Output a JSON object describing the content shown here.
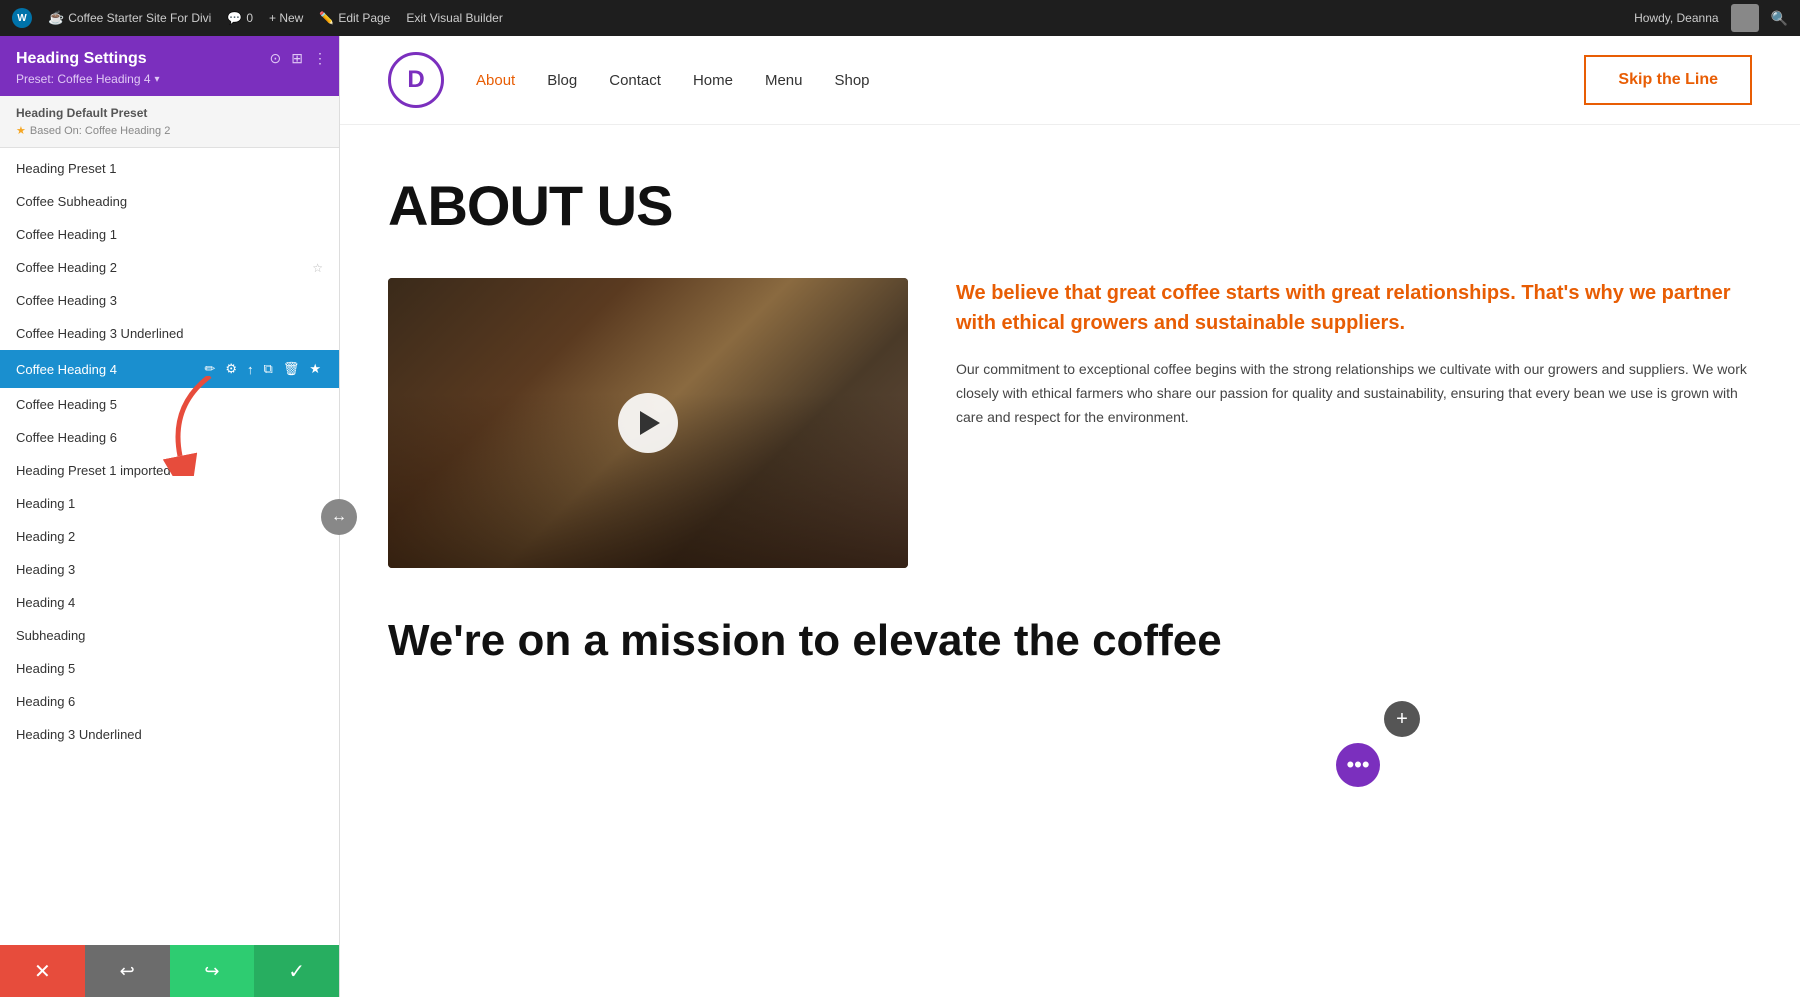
{
  "adminBar": {
    "siteName": "Coffee Starter Site For Divi",
    "commentCount": "0",
    "newLabel": "+ New",
    "editPageLabel": "Edit Page",
    "exitBuilderLabel": "Exit Visual Builder",
    "howdy": "Howdy, Deanna"
  },
  "panel": {
    "title": "Heading Settings",
    "presetLabel": "Preset: Coffee Heading 4",
    "defaultPreset": {
      "title": "Heading Default Preset",
      "basedOn": "Based On: Coffee Heading 2"
    },
    "presetList": [
      {
        "id": 1,
        "label": "Heading Preset 1",
        "active": false,
        "starred": false
      },
      {
        "id": 2,
        "label": "Coffee Subheading",
        "active": false,
        "starred": false
      },
      {
        "id": 3,
        "label": "Coffee Heading 1",
        "active": false,
        "starred": false
      },
      {
        "id": 4,
        "label": "Coffee Heading 2",
        "active": false,
        "starred": true
      },
      {
        "id": 5,
        "label": "Coffee Heading 3",
        "active": false,
        "starred": false
      },
      {
        "id": 6,
        "label": "Coffee Heading 3 Underlined",
        "active": false,
        "starred": false
      },
      {
        "id": 7,
        "label": "Coffee Heading 4",
        "active": true,
        "starred": true
      },
      {
        "id": 8,
        "label": "Coffee Heading 5",
        "active": false,
        "starred": false
      },
      {
        "id": 9,
        "label": "Coffee Heading 6",
        "active": false,
        "starred": false
      },
      {
        "id": 10,
        "label": "Heading Preset 1 imported",
        "active": false,
        "starred": false
      },
      {
        "id": 11,
        "label": "Heading 1",
        "active": false,
        "starred": false
      },
      {
        "id": 12,
        "label": "Heading 2",
        "active": false,
        "starred": false
      },
      {
        "id": 13,
        "label": "Heading 3",
        "active": false,
        "starred": false
      },
      {
        "id": 14,
        "label": "Heading 4",
        "active": false,
        "starred": false
      },
      {
        "id": 15,
        "label": "Subheading",
        "active": false,
        "starred": false
      },
      {
        "id": 16,
        "label": "Heading 5",
        "active": false,
        "starred": false
      },
      {
        "id": 17,
        "label": "Heading 6",
        "active": false,
        "starred": false
      },
      {
        "id": 18,
        "label": "Heading 3 Underlined",
        "active": false,
        "starred": false
      }
    ]
  },
  "siteHeader": {
    "logoLetter": "D",
    "navItems": [
      "About",
      "Blog",
      "Contact",
      "Home",
      "Menu",
      "Shop"
    ],
    "activeNav": "About",
    "skipBtnLabel": "Skip the Line"
  },
  "pageContent": {
    "heroTitle": "ABOUT US",
    "quoteText": "We believe that great coffee starts with great relationships. That's why we partner with ethical growers and sustainable suppliers.",
    "bodyText": "Our commitment to exceptional coffee begins with the strong relationships we cultivate with our growers and suppliers. We work closely with ethical farmers who share our passion for quality and sustainability, ensuring that every bean we use is grown with care and respect for the environment.",
    "missionTitle": "We're on a mission to elevate the coffee"
  },
  "actionBar": {
    "cancelIcon": "✕",
    "undoIcon": "↩",
    "redoIcon": "↪",
    "saveIcon": "✓"
  },
  "colors": {
    "purple": "#7b2fbe",
    "orange": "#e85d04",
    "blue": "#1a8fcf",
    "green": "#27ae60",
    "red": "#e74c3c"
  }
}
